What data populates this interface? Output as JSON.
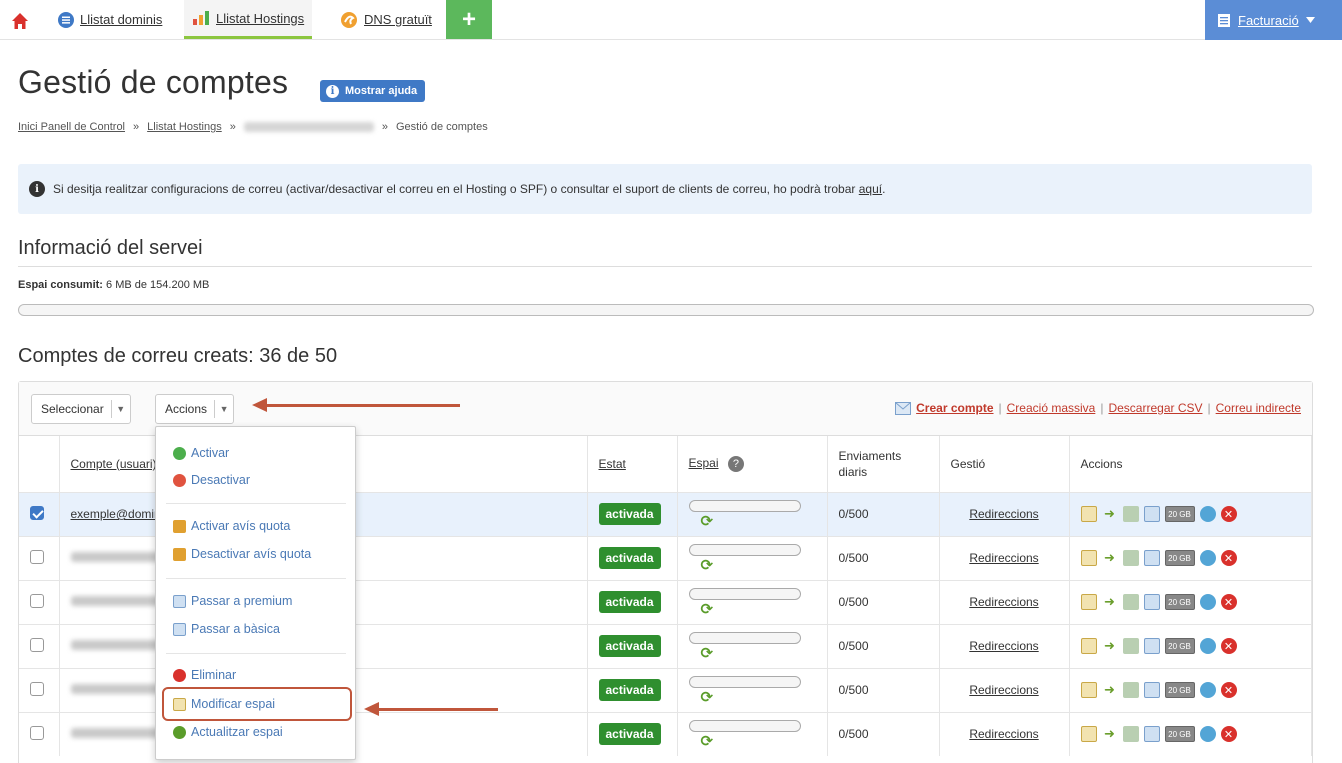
{
  "nav": {
    "tabs": [
      {
        "label": "Llistat dominis",
        "icon": "list-circle-icon"
      },
      {
        "label": "Llistat Hostings",
        "icon": "bar-chart-icon"
      },
      {
        "label": "DNS gratuït",
        "icon": "dns-icon"
      }
    ],
    "add_symbol": "+",
    "billing_label": "Facturació"
  },
  "header": {
    "title": "Gestió de comptes",
    "help_button": "Mostrar ajuda"
  },
  "breadcrumb": {
    "items": [
      "Inici Panell de Control",
      "Llistat Hostings",
      "Gestió de comptes"
    ],
    "separator": "»"
  },
  "info": {
    "text": "Si desitja realitzar configuracions de correu (activar/desactivar el correu en el Hosting o SPF) o consultar el suport de clients de correu, ho podrà trobar",
    "link": "aquí",
    "end": "."
  },
  "service": {
    "title": "Informació del servei",
    "label": "Espai consumit:",
    "value": "6 MB de 154.200 MB",
    "usage_fraction": 0.0
  },
  "accounts": {
    "title": "Comptes de correu creats: 36 de 50",
    "select_btn": "Seleccionar",
    "actions_btn": "Accions",
    "links": [
      "Crear compte",
      "Creació massiva",
      "Descarregar CSV",
      "Correu indirecte"
    ],
    "link_sep": "|",
    "columns": {
      "account": "Compte (usuari)",
      "status": "Estat",
      "space": "Espai",
      "sends": "Enviaments diaris",
      "manage": "Gestió",
      "actions": "Accions"
    },
    "rows": [
      {
        "name": "exemple@domini.com",
        "status": "activada",
        "sends": "0/500",
        "manage": "Redireccions",
        "checked": true,
        "usage_fraction": 0.0
      },
      {
        "name": "",
        "status": "activada",
        "sends": "0/500",
        "manage": "Redireccions",
        "checked": false,
        "usage_fraction": 0.0
      },
      {
        "name": "",
        "status": "activada",
        "sends": "0/500",
        "manage": "Redireccions",
        "checked": false,
        "usage_fraction": 0.0
      },
      {
        "name": "",
        "status": "activada",
        "sends": "0/500",
        "manage": "Redireccions",
        "checked": false,
        "usage_fraction": 0.0
      },
      {
        "name": "",
        "status": "activada",
        "sends": "0/500",
        "manage": "Redireccions",
        "checked": false,
        "usage_fraction": 0.0
      },
      {
        "name": "",
        "status": "activada",
        "sends": "0/500",
        "manage": "Redireccions",
        "checked": false,
        "usage_fraction": 0.0
      }
    ],
    "quota_badge": "20 GB"
  },
  "menu": {
    "items": [
      {
        "label": "Activar",
        "icon": "activate-icon",
        "color": "#4cae4c"
      },
      {
        "label": "Desactivar",
        "icon": "deactivate-icon",
        "color": "#e0533f"
      },
      {
        "label": "Activar avís quota",
        "icon": "quota-alert-on-icon",
        "color": "#e0a030"
      },
      {
        "label": "Desactivar avís quota",
        "icon": "quota-alert-off-icon",
        "color": "#e0a030"
      },
      {
        "label": "Passar a premium",
        "icon": "premium-mail-icon",
        "color": "#7aa0cc"
      },
      {
        "label": "Passar a bàsica",
        "icon": "basic-mail-icon",
        "color": "#7aa0cc"
      },
      {
        "label": "Eliminar",
        "icon": "delete-icon",
        "color": "#d9312c"
      },
      {
        "label": "Modificar espai",
        "icon": "edit-space-icon",
        "color": "#c9a847"
      },
      {
        "label": "Actualitzar espai",
        "icon": "refresh-space-icon",
        "color": "#5a9c2a"
      }
    ]
  },
  "colors": {
    "accent": "#3f79c6",
    "active": "#2f8f2f",
    "highlight": "#c0563b",
    "link": "#c0392b"
  }
}
